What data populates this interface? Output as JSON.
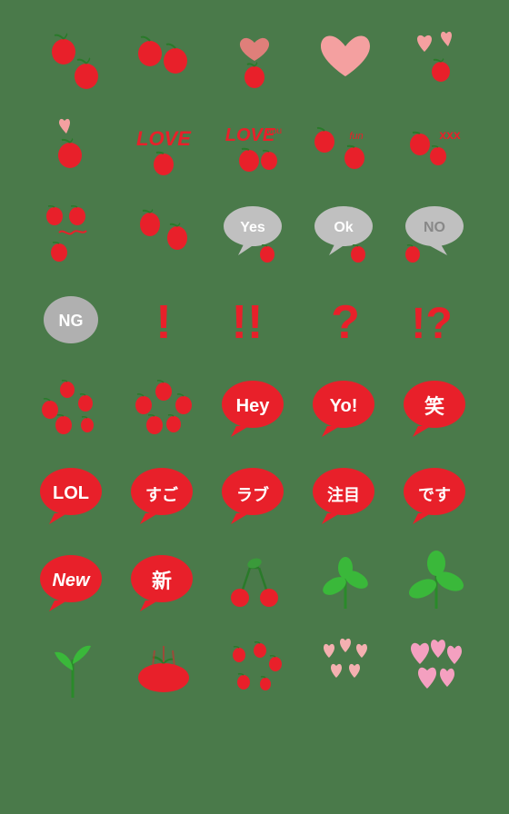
{
  "grid": {
    "rows": 9,
    "cols": 5,
    "bg_color": "#4a7a4a"
  },
  "cells": [
    {
      "id": 0,
      "type": "two-apples-diagonal",
      "label": "two apples"
    },
    {
      "id": 1,
      "type": "two-apples-cluster",
      "label": "two apples cluster"
    },
    {
      "id": 2,
      "type": "heart-pink-apple",
      "label": "heart and apple"
    },
    {
      "id": 3,
      "type": "heart-peach-big",
      "label": "big peach heart"
    },
    {
      "id": 4,
      "type": "heart-pink-small",
      "label": "small pink hearts"
    },
    {
      "id": 5,
      "type": "heart-apple-below",
      "label": "heart with apple below"
    },
    {
      "id": 6,
      "type": "love-text",
      "label": "LOVE red text"
    },
    {
      "id": 7,
      "type": "love-text-apple",
      "label": "LOVE with apple"
    },
    {
      "id": 8,
      "type": "apple-fun-text",
      "label": "apple fun"
    },
    {
      "id": 9,
      "type": "xxx-apples",
      "label": "xxx apples"
    },
    {
      "id": 10,
      "type": "apple-dots",
      "label": "apple dots"
    },
    {
      "id": 11,
      "type": "apple-two-v2",
      "label": "two apples v2"
    },
    {
      "id": 12,
      "type": "yes-bubble",
      "label": "Yes bubble"
    },
    {
      "id": 13,
      "type": "ok-bubble",
      "label": "Ok bubble"
    },
    {
      "id": 14,
      "type": "no-bubble",
      "label": "NO bubble"
    },
    {
      "id": 15,
      "type": "ng-bubble",
      "label": "NG bubble"
    },
    {
      "id": 16,
      "type": "exclaim-one",
      "label": "exclamation one"
    },
    {
      "id": 17,
      "type": "exclaim-two",
      "label": "exclamation two"
    },
    {
      "id": 18,
      "type": "question",
      "label": "question mark"
    },
    {
      "id": 19,
      "type": "exclaim-question",
      "label": "exclaim question"
    },
    {
      "id": 20,
      "type": "apples-splash",
      "label": "apples splash"
    },
    {
      "id": 21,
      "type": "apples-heart",
      "label": "apples heart"
    },
    {
      "id": 22,
      "type": "hey-bubble",
      "label": "Hey bubble"
    },
    {
      "id": 23,
      "type": "yo-bubble",
      "label": "Yo! bubble"
    },
    {
      "id": 24,
      "type": "wara-bubble",
      "label": "笑 bubble"
    },
    {
      "id": 25,
      "type": "lol-bubble",
      "label": "LOL bubble"
    },
    {
      "id": 26,
      "type": "sugo-bubble",
      "label": "すご bubble"
    },
    {
      "id": 27,
      "type": "rabu-bubble",
      "label": "ラブ bubble"
    },
    {
      "id": 28,
      "type": "chyumoku-bubble",
      "label": "注目 bubble"
    },
    {
      "id": 29,
      "type": "desu-bubble",
      "label": "です bubble"
    },
    {
      "id": 30,
      "type": "new-bubble",
      "label": "New bubble"
    },
    {
      "id": 31,
      "type": "shin-bubble",
      "label": "新 bubble"
    },
    {
      "id": 32,
      "type": "cherry-green",
      "label": "cherry green"
    },
    {
      "id": 33,
      "type": "green-plant",
      "label": "green plant"
    },
    {
      "id": 34,
      "type": "green-plant2",
      "label": "green plant 2"
    },
    {
      "id": 35,
      "type": "stem-only",
      "label": "stem only"
    },
    {
      "id": 36,
      "type": "apple-squish",
      "label": "apple squish"
    },
    {
      "id": 37,
      "type": "apple-dots-small",
      "label": "apple dots small"
    },
    {
      "id": 38,
      "type": "hearts-pink-small",
      "label": "small pink hearts"
    },
    {
      "id": 39,
      "type": "hearts-pink-medium",
      "label": "medium pink hearts"
    },
    {
      "id": 40,
      "type": "empty",
      "label": "empty"
    },
    {
      "id": 41,
      "type": "empty",
      "label": "empty"
    },
    {
      "id": 42,
      "type": "empty",
      "label": "empty"
    },
    {
      "id": 43,
      "type": "empty",
      "label": "empty"
    },
    {
      "id": 44,
      "type": "empty",
      "label": "empty"
    }
  ]
}
